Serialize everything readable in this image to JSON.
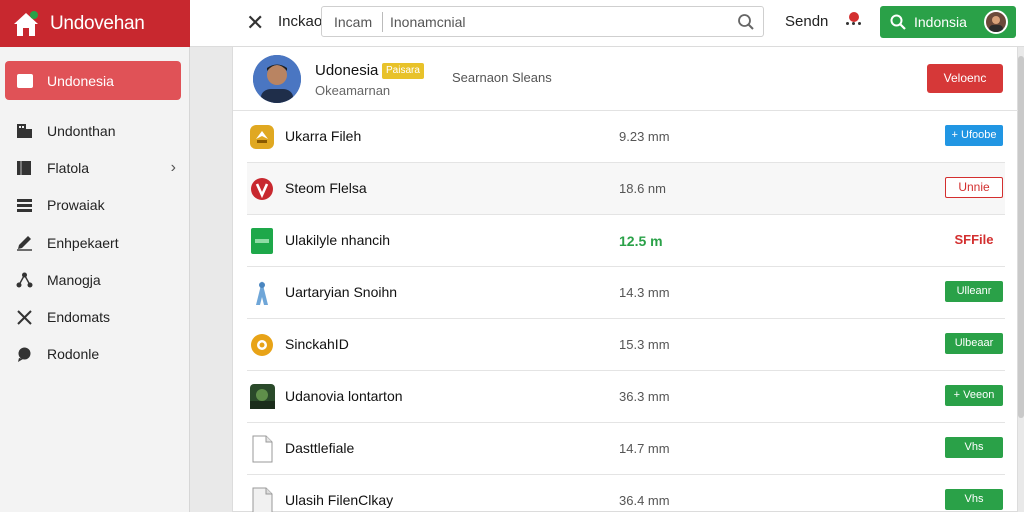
{
  "brand": {
    "title": "Undovehan"
  },
  "topbar": {
    "label": "Inckao",
    "search_scope": "Incam",
    "search_value": "Inonamcnial",
    "right_label": "Sendn",
    "account_label": "Indonsia"
  },
  "sidebar": {
    "active": "Undonesia",
    "items": [
      {
        "label": "Undonthan",
        "icon": "building-icon"
      },
      {
        "label": "Flatola",
        "icon": "book-icon"
      },
      {
        "label": "Prowaiak",
        "icon": "list-icon"
      },
      {
        "label": "Enhpekaert",
        "icon": "pencil-icon"
      },
      {
        "label": "Manogja",
        "icon": "network-icon"
      },
      {
        "label": "Endomats",
        "icon": "tools-icon"
      },
      {
        "label": "Rodonle",
        "icon": "chat-icon"
      }
    ]
  },
  "profile": {
    "name": "Udonesia",
    "tag": "Paisara",
    "subtitle": "Okeamarnan",
    "middle": "Searnaon Sleans",
    "button": "Veloenc"
  },
  "files": [
    {
      "name": "Ukarra Fileh",
      "size": "9.23 mm",
      "action": "+ Ufoobe",
      "icon": "gold-badge-icon"
    },
    {
      "name": "Steom Flelsa",
      "size": "18.6 nm",
      "action": "Unnie",
      "icon": "red-v-icon"
    },
    {
      "name": "Ulakilyle nhancih",
      "size": "12.5 m",
      "action": "SFFile",
      "icon": "green-sheet-icon"
    },
    {
      "name": "Uartaryian Snoihn",
      "size": "14.3 mm",
      "action": "Ulleanr",
      "icon": "blue-figure-icon"
    },
    {
      "name": "SinckahID",
      "size": "15.3 mm",
      "action": "Ulbeaar",
      "icon": "gold-gear-icon"
    },
    {
      "name": "Udanovia lontarton",
      "size": "36.3 mm",
      "action": "+ Veeon",
      "icon": "photo-icon"
    },
    {
      "name": "Dasttlefiale",
      "size": "14.7 mm",
      "action": "Vhs",
      "icon": "document-icon"
    },
    {
      "name": "Ulasih FilenClkay",
      "size": "36.4 mm",
      "action": "Vhs",
      "icon": "document-icon"
    }
  ],
  "colors": {
    "brand": "#c8282f",
    "sidebar_active": "#e05257",
    "success": "#2aa148",
    "info": "#2196e3",
    "danger": "#d32f2f"
  }
}
